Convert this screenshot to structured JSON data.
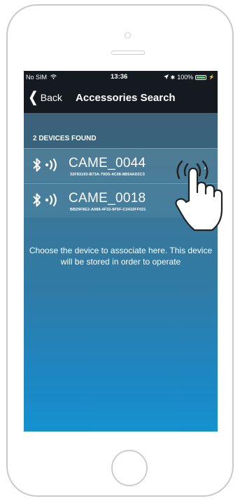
{
  "status_bar": {
    "carrier": "No SIM",
    "time": "13:36",
    "battery": "100%"
  },
  "nav": {
    "back_label": "Back",
    "title": "Accessories Search"
  },
  "section": {
    "header": "2 DEVICES FOUND"
  },
  "devices": [
    {
      "name": "CAME_0044",
      "uuid": "32F93193-B73A-79D5-4C08-8B54AD2C3"
    },
    {
      "name": "CAME_0018",
      "uuid": "BB29F8E2-A088-4F32-8F5F-C2432FF021"
    }
  ],
  "info": {
    "text": "Choose the device to associate here. This device will be stored in order to operate"
  },
  "icons": {
    "bluetooth": "bluetooth-icon",
    "signal": "signal-waves-icon",
    "hand": "hand-pointer-icon"
  },
  "colors": {
    "nav_bg": "#141a1f",
    "screen_top": "#4b6f86",
    "screen_bottom": "#1591d0",
    "battery": "#4cd964"
  }
}
